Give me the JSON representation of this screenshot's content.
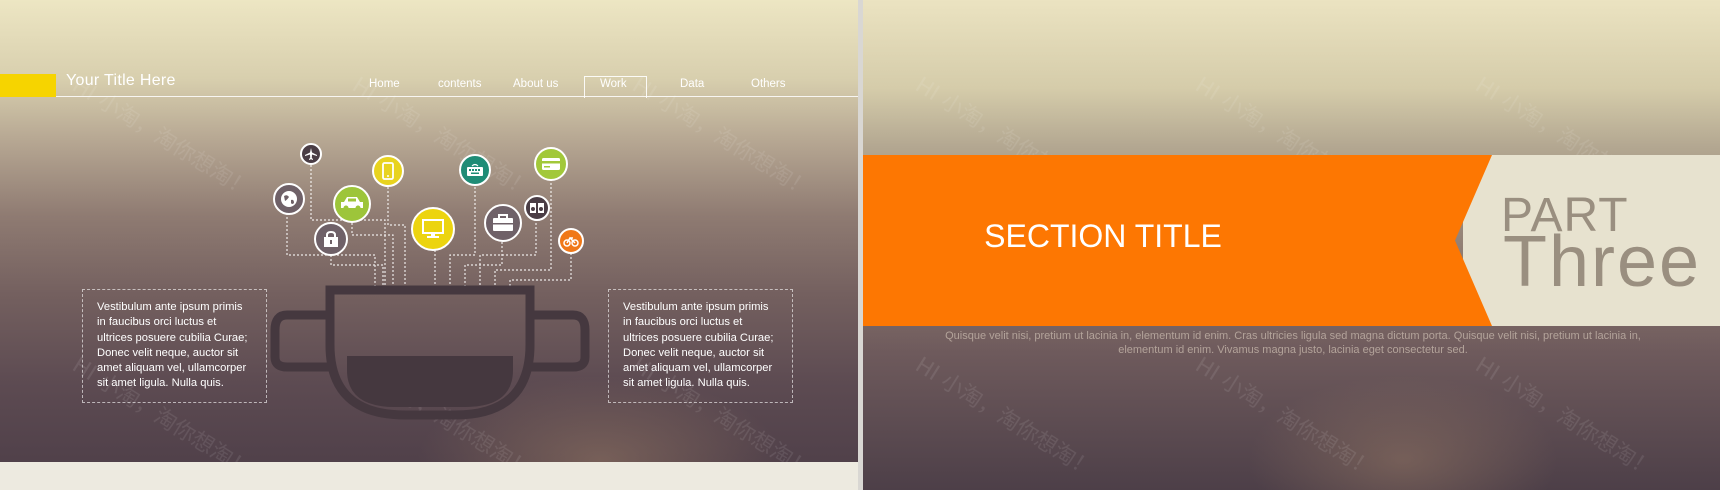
{
  "left_slide": {
    "header": {
      "site_title": "Your  Title  Here",
      "nav": [
        {
          "label": "Home"
        },
        {
          "label": "contents"
        },
        {
          "label": "About us"
        },
        {
          "label": "Work",
          "active": true
        },
        {
          "label": "Data"
        },
        {
          "label": "Others"
        }
      ]
    },
    "left_text": "Vestibulum ante ipsum primis in faucibus orci luctus et ultrices posuere cubilia Curae; Donec velit neque, auctor sit amet aliquam vel, ullamcorper sit amet ligula. Nulla quis.",
    "right_text": "Vestibulum ante ipsum primis in faucibus orci luctus et ultrices posuere cubilia Curae; Donec velit neque, auctor sit amet aliquam vel, ullamcorper sit amet ligula. Nulla quis.",
    "icons": [
      {
        "name": "airplane-icon",
        "color": "#4a3d45"
      },
      {
        "name": "globe-icon",
        "color": "#6f6168"
      },
      {
        "name": "car-icon",
        "color": "#9dc53a"
      },
      {
        "name": "phone-icon",
        "color": "#e8d31f"
      },
      {
        "name": "lock-icon",
        "color": "#6f6168"
      },
      {
        "name": "monitor-icon",
        "color": "#ecd40f"
      },
      {
        "name": "keyboard-icon",
        "color": "#1f8c76"
      },
      {
        "name": "briefcase-icon",
        "color": "#6f6168"
      },
      {
        "name": "credit-card-icon",
        "color": "#a2c83a"
      },
      {
        "name": "speaker-icon",
        "color": "#4a3d45"
      },
      {
        "name": "bicycle-icon",
        "color": "#f07818"
      }
    ],
    "colors": {
      "accent_yellow": "#f6d400",
      "pot": "#45383f"
    }
  },
  "right_slide": {
    "section_title": "SECTION TITLE",
    "part_label": "PART",
    "part_number": "Three",
    "body_text": "Quisque velit nisi, pretium ut lacinia in, elementum id enim. Cras ultricies ligula sed magna dictum porta. Quisque velit nisi, pretium ut lacinia in, elementum id enim. Vivamus magna justo, lacinia eget consectetur sed.",
    "colors": {
      "band": "#fd7702",
      "panel": "#e7e2cf",
      "part_text": "#9a8f80"
    }
  }
}
